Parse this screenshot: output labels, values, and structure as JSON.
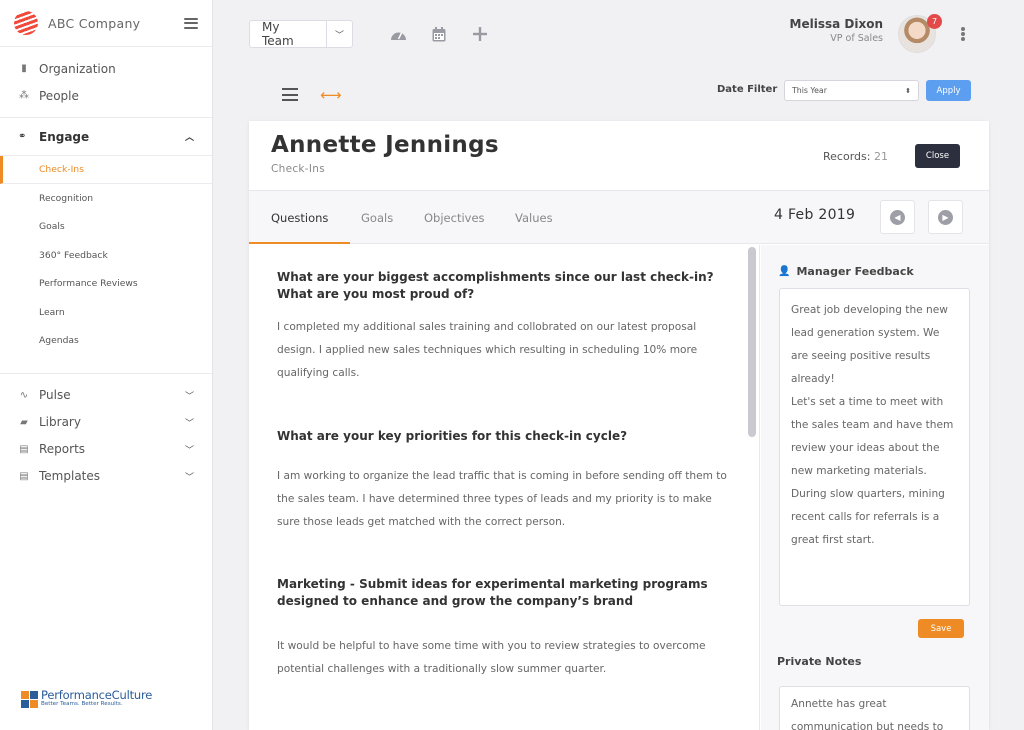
{
  "brand": {
    "name": "ABC Company"
  },
  "sidebar": {
    "top_items": [
      {
        "label": "Organization",
        "icon": "building-icon"
      },
      {
        "label": "People",
        "icon": "people-icon"
      }
    ],
    "engage": {
      "label": "Engage",
      "items": [
        {
          "label": "Check-Ins",
          "active": true
        },
        {
          "label": "Recognition"
        },
        {
          "label": "Goals"
        },
        {
          "label": "360° Feedback"
        },
        {
          "label": "Performance Reviews"
        },
        {
          "label": "Learn"
        },
        {
          "label": "Agendas"
        }
      ]
    },
    "lower_items": [
      {
        "label": "Pulse",
        "icon": "pulse-icon"
      },
      {
        "label": "Library",
        "icon": "book-icon"
      },
      {
        "label": "Reports",
        "icon": "document-icon"
      },
      {
        "label": "Templates",
        "icon": "document-icon"
      }
    ],
    "footer_logo": {
      "title": "PerformanceCulture",
      "tagline": "Better Teams. Better Results."
    }
  },
  "topbar": {
    "team_select": "My Team",
    "icons": [
      "dashboard-icon",
      "calendar-icon",
      "plus-icon"
    ],
    "user": {
      "name": "Melissa Dixon",
      "role": "VP of Sales",
      "notifications": "7"
    }
  },
  "toolbar": {
    "date_filter_label": "Date Filter",
    "date_filter_value": "This Year",
    "apply_label": "Apply"
  },
  "card": {
    "name": "Annette Jennings",
    "subtitle": "Check-Ins",
    "records_label": "Records:",
    "records_value": "21",
    "close_label": "Close",
    "tabs": [
      "Questions",
      "Goals",
      "Objectives",
      "Values"
    ],
    "date": "4 Feb 2019"
  },
  "qa": [
    {
      "question": "What are your biggest accomplishments since our last check-in? What are you most proud of?",
      "answer": "I completed my additional sales training and collobrated on our latest proposal design.  I applied new sales techniques which resulting in scheduling 10% more qualifying calls."
    },
    {
      "question": "What are your key priorities for this check-in cycle?",
      "answer": "I am working to organize the lead traffic that is coming in before sending off them to the sales team. I have determined three types of leads and my priority is to make sure those leads get matched with the correct person."
    },
    {
      "question": "Marketing - Submit ideas for experimental marketing programs designed to enhance and grow the company’s brand",
      "answer": "It would be helpful to have some time with you to review strategies to overcome potential challenges with a traditionally slow summer quarter."
    }
  ],
  "feedback": {
    "title": "Manager Feedback",
    "paragraphs": [
      "Great job developing the new lead generation system. We are seeing positive results already!",
      "Let's set a time to meet with the sales team and have them review your ideas about the new marketing materials.",
      "During slow quarters, mining recent calls for referrals is a great first start."
    ],
    "save_label": "Save",
    "private_notes_title": "Private Notes",
    "private_notes_text": "Annette has great communication but needs to"
  }
}
